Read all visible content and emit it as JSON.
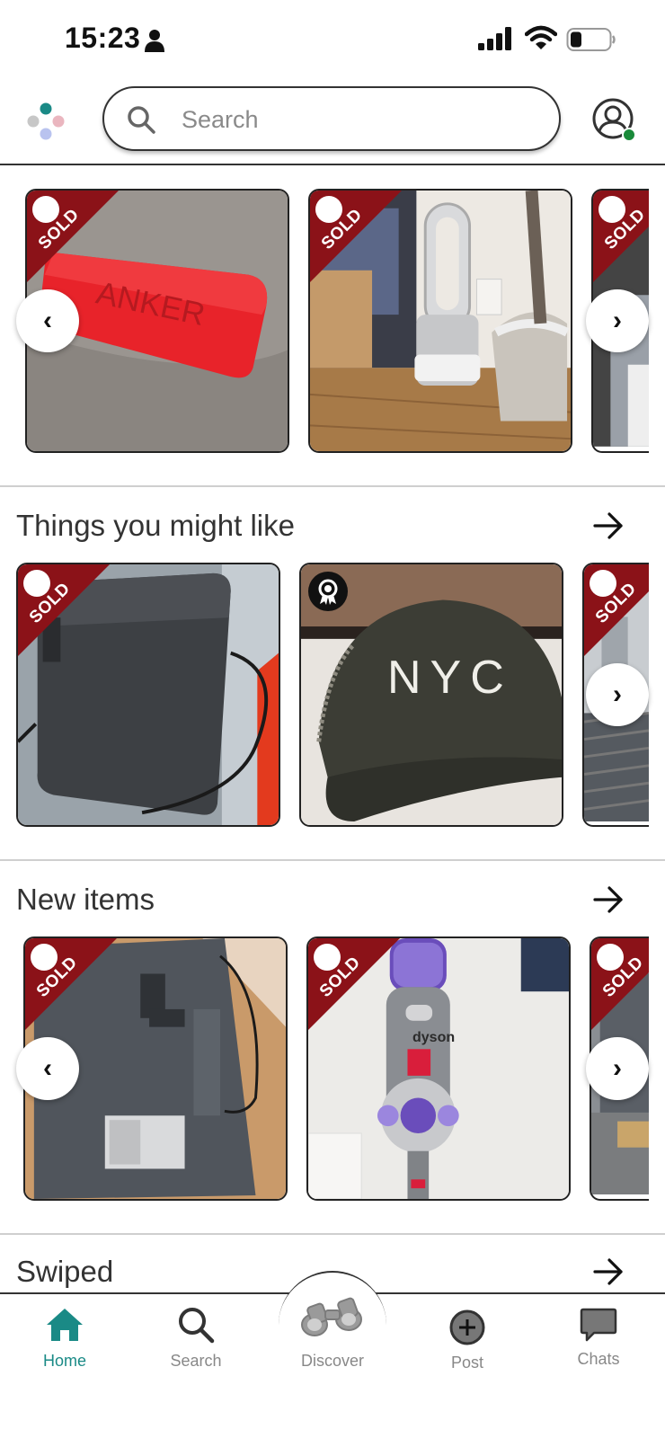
{
  "status_bar": {
    "time": "15:23",
    "icons": [
      "person-icon",
      "signal-icon",
      "wifi-icon",
      "battery-icon"
    ]
  },
  "header": {
    "logo": "app-logo",
    "search": {
      "placeholder": "Search"
    },
    "avatar": "profile-avatar-icon",
    "online_status_color": "#1a8a3a"
  },
  "sold_label": "SOLD",
  "colors": {
    "sold_ribbon": "#8b1218",
    "accent": "#1a8a86"
  },
  "sections": [
    {
      "title": "",
      "items": [
        {
          "photo": "red-anker-speaker",
          "status": "SOLD"
        },
        {
          "photo": "dyson-purifier-fan",
          "status": "SOLD"
        },
        {
          "photo": "partial-item",
          "status": "SOLD"
        }
      ]
    },
    {
      "title": "Things you might like",
      "items": [
        {
          "photo": "black-router",
          "status": "SOLD"
        },
        {
          "photo": "nyc-cap",
          "status": "award-badge",
          "cap_text": "NYC"
        },
        {
          "photo": "partial-item",
          "status": "SOLD"
        }
      ]
    },
    {
      "title": "New items",
      "items": [
        {
          "photo": "tv-back-panel",
          "status": "SOLD"
        },
        {
          "photo": "dyson-vacuum",
          "status": "SOLD",
          "brand_text": "dyson"
        },
        {
          "photo": "partial-item",
          "status": "SOLD"
        }
      ]
    },
    {
      "title": "Swiped",
      "items": []
    }
  ],
  "bottom_nav": [
    {
      "label": "Home",
      "icon": "home-icon",
      "active": true
    },
    {
      "label": "Search",
      "icon": "search-icon",
      "active": false
    },
    {
      "label": "Discover",
      "icon": "binoculars-icon",
      "active": false
    },
    {
      "label": "Post",
      "icon": "plus-circle-icon",
      "active": false
    },
    {
      "label": "Chats",
      "icon": "chat-bubble-icon",
      "active": false
    }
  ]
}
